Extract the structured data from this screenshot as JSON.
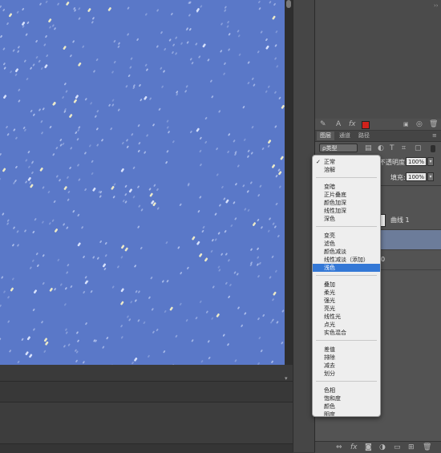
{
  "layers_panel": {
    "tabs": [
      {
        "label": "图层",
        "active": true
      },
      {
        "label": "通道",
        "active": false
      },
      {
        "label": "路径",
        "active": false
      }
    ],
    "filter_kind": "ρ类型",
    "opacity_label": "不透明度:",
    "opacity_value": "100%",
    "fill_label": "填充:",
    "fill_value": "100%",
    "layers": [
      {
        "name": "曲线 1",
        "selected": false
      },
      {
        "name": "",
        "selected": true
      },
      {
        "name": "0",
        "selected": false
      }
    ],
    "adj_icons": [
      "brush-icon",
      "text-icon",
      "fx-icon",
      "color-swatch-icon"
    ],
    "accent_color": "#d0221c"
  },
  "blend_menu": {
    "selected": "正常",
    "highlighted": "浅色",
    "groups": [
      [
        "正常",
        "溶解"
      ],
      [
        "变暗",
        "正片叠底",
        "颜色加深",
        "线性加深",
        "深色"
      ],
      [
        "变亮",
        "滤色",
        "颜色减淡",
        "线性减淡（添加）",
        "浅色"
      ],
      [
        "叠加",
        "柔光",
        "强光",
        "亮光",
        "线性光",
        "点光",
        "实色混合"
      ],
      [
        "差值",
        "排除",
        "减去",
        "划分"
      ],
      [
        "色相",
        "饱和度",
        "颜色",
        "明度"
      ]
    ]
  },
  "colors": {
    "canvas": "#5a78c8",
    "menu_highlight": "#3478d6",
    "panel_bg": "#535353"
  }
}
